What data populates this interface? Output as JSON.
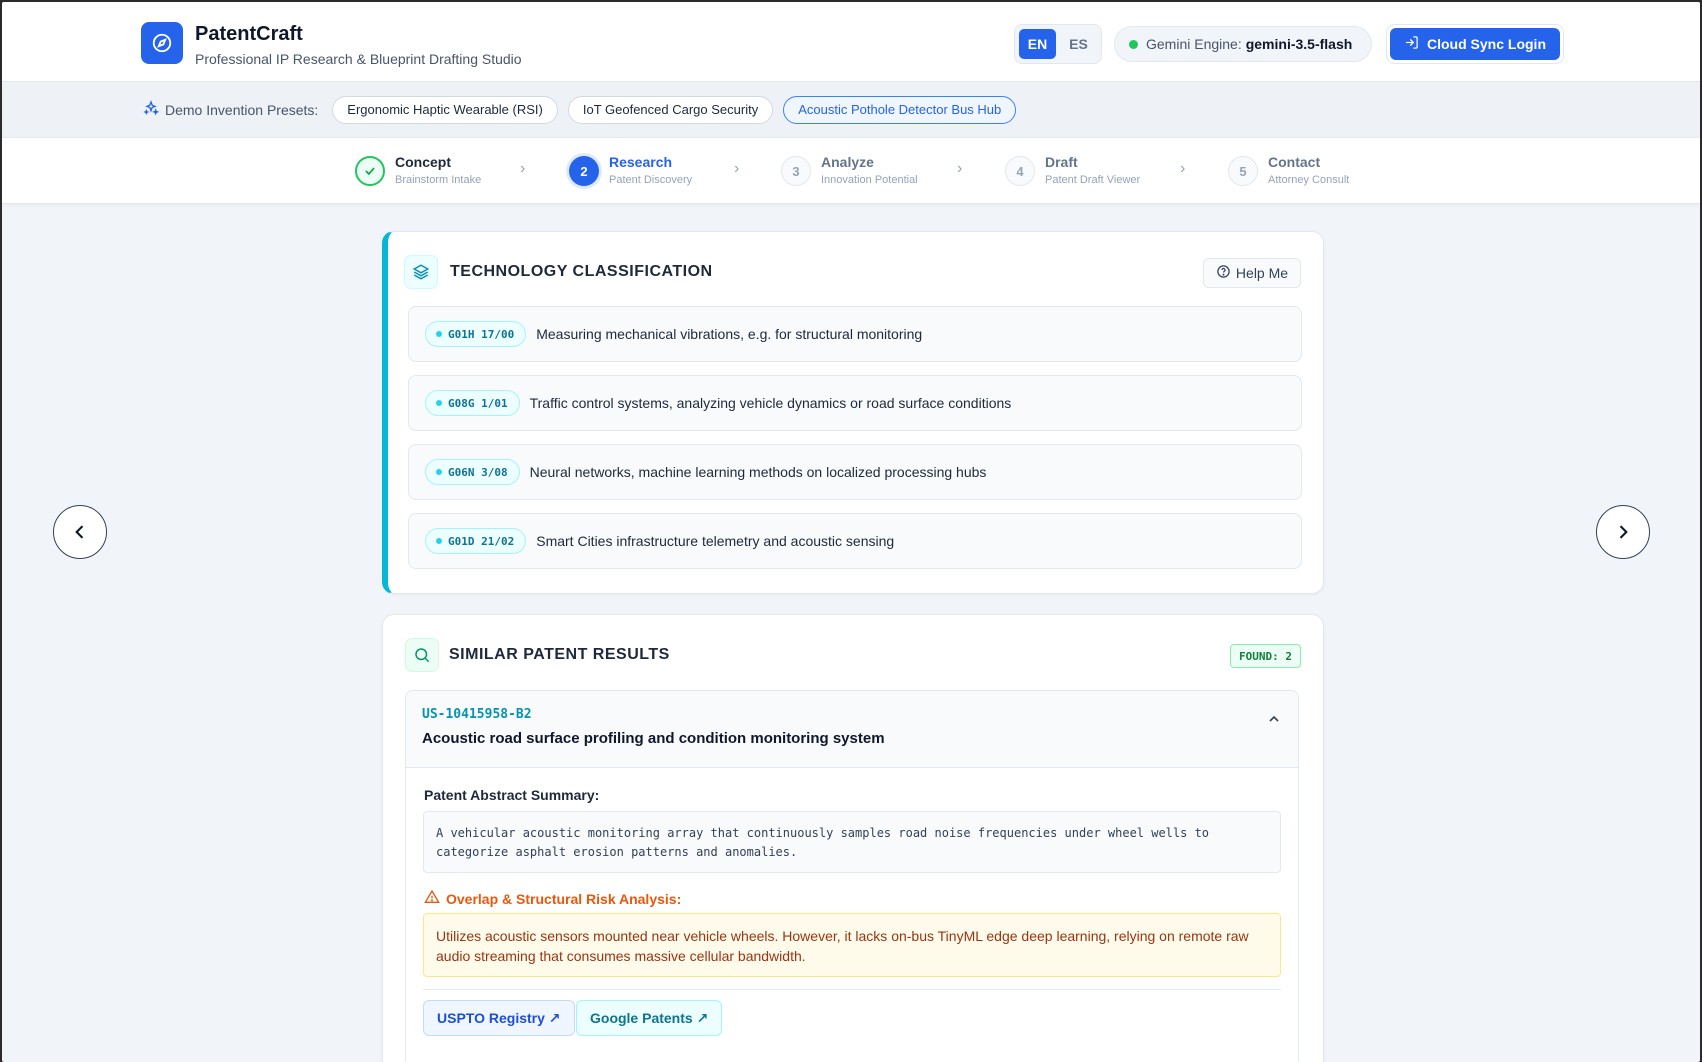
{
  "header": {
    "app_title": "PatentCraft",
    "app_subtitle": "Professional IP Research & Blueprint Drafting Studio",
    "lang_en": "EN",
    "lang_es": "ES",
    "engine_label": "Gemini Engine:",
    "engine_value": "gemini-3.5-flash",
    "cloud_button": "Cloud Sync Login"
  },
  "presets": {
    "label": "Demo Invention Presets:",
    "items": [
      {
        "label": "Ergonomic Haptic Wearable (RSI)"
      },
      {
        "label": "IoT Geofenced Cargo Security"
      },
      {
        "label": "Acoustic Pothole Detector Bus Hub"
      }
    ],
    "active_index": 2
  },
  "stepper": {
    "steps": [
      {
        "number": "✓",
        "name": "Concept",
        "desc": "Brainstorm Intake",
        "state": "done"
      },
      {
        "number": "2",
        "name": "Research",
        "desc": "Patent Discovery",
        "state": "current"
      },
      {
        "number": "3",
        "name": "Analyze",
        "desc": "Innovation Potential",
        "state": "todo"
      },
      {
        "number": "4",
        "name": "Draft",
        "desc": "Patent Draft Viewer",
        "state": "todo"
      },
      {
        "number": "5",
        "name": "Contact",
        "desc": "Attorney Consult",
        "state": "todo"
      }
    ]
  },
  "tech": {
    "title": "TECHNOLOGY CLASSIFICATION",
    "help": "Help Me",
    "rows": [
      {
        "code": "G01H 17/00",
        "desc": "Measuring mechanical vibrations, e.g. for structural monitoring"
      },
      {
        "code": "G08G 1/01",
        "desc": "Traffic control systems, analyzing vehicle dynamics or road surface conditions"
      },
      {
        "code": "G06N 3/08",
        "desc": "Neural networks, machine learning methods on localized processing hubs"
      },
      {
        "code": "G01D 21/02",
        "desc": "Smart Cities infrastructure telemetry and acoustic sensing"
      }
    ]
  },
  "similar": {
    "title": "SIMILAR PATENT RESULTS",
    "found": "FOUND: 2",
    "patent": {
      "id": "US-10415958-B2",
      "title": "Acoustic road surface profiling and condition monitoring system",
      "abstract_label": "Patent Abstract Summary:",
      "abstract": "A vehicular acoustic monitoring array that continuously samples road noise frequencies under wheel wells to categorize asphalt erosion patterns and anomalies.",
      "risk_label": "Overlap & Structural Risk Analysis:",
      "risk": "Utilizes acoustic sensors mounted near vehicle wheels. However, it lacks on-bus TinyML edge deep learning, relying on remote raw audio streaming that consumes massive cellular bandwidth.",
      "uspto_link": "USPTO Registry ↗",
      "google_link": "Google Patents ↗"
    }
  },
  "colors": {
    "accent": "#2563eb",
    "cyan": "#06b6d4",
    "success": "#22c55e",
    "warning": "#ea580c"
  }
}
